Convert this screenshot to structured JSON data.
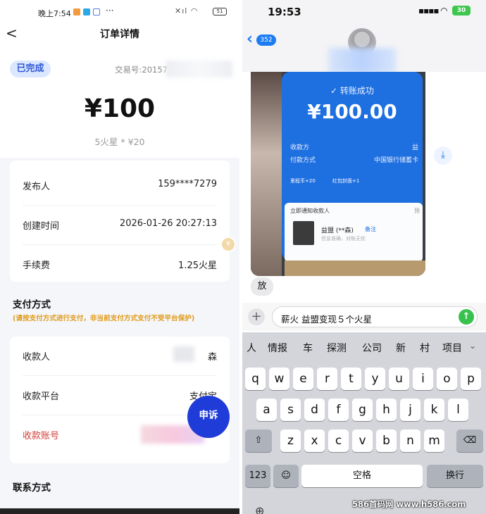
{
  "left": {
    "status": {
      "time": "晚上7:54",
      "dots": "···",
      "battery": "51"
    },
    "nav": {
      "back": "<",
      "title": "订单详情"
    },
    "order": {
      "status": "已完成",
      "tx_label": "交易号:20157",
      "amount": "¥100",
      "amount_sub": "5火星 * ¥20"
    },
    "info_rows": [
      {
        "key": "发布人",
        "value": "159****7279"
      },
      {
        "key": "创建时间",
        "value": "2026-01-26 20:27:13"
      },
      {
        "key": "手续费",
        "value": "1.25火星"
      }
    ],
    "payment": {
      "title": "支付方式",
      "note": "(请按支付方式进行支付，非当前支付方式支付不受平台保护)",
      "rows": [
        {
          "key": "收款人",
          "value": "森"
        },
        {
          "key": "收款平台",
          "value": "支付宝"
        },
        {
          "key": "收款账号",
          "value": ""
        }
      ]
    },
    "appeal": "申诉",
    "contact_title": "联系方式"
  },
  "right": {
    "status": {
      "time": "19:53",
      "battery": "30"
    },
    "nav": {
      "unread_count": "352"
    },
    "photo": {
      "success": "转账成功",
      "amount": "¥100.00",
      "rows": [
        {
          "key": "收款方",
          "value": "益"
        },
        {
          "key": "付款方式",
          "value": "中国银行储蓄卡"
        }
      ],
      "chips": [
        "里程币+20",
        "红包封面+1"
      ],
      "notify": "立即通知收款人",
      "preview": "预",
      "payee": "益盟 (**森)",
      "payee_note": "备注",
      "payee_line": "信息准确，对账无忧"
    },
    "bubble": "放",
    "input_text": "薪火 益盟变现５个火星",
    "candidates": [
      "人",
      "情报",
      "车",
      "探测",
      "公司",
      "新",
      "村",
      "项目"
    ],
    "keys_row1": [
      "q",
      "w",
      "e",
      "r",
      "t",
      "y",
      "u",
      "i",
      "o",
      "p"
    ],
    "keys_row2": [
      "a",
      "s",
      "d",
      "f",
      "g",
      "h",
      "j",
      "k",
      "l"
    ],
    "keys_row3": [
      "z",
      "x",
      "c",
      "v",
      "b",
      "n",
      "m"
    ],
    "key_123": "123",
    "key_space": "空格",
    "key_return": "换行"
  },
  "watermark": "586首码网 www.h586.com"
}
